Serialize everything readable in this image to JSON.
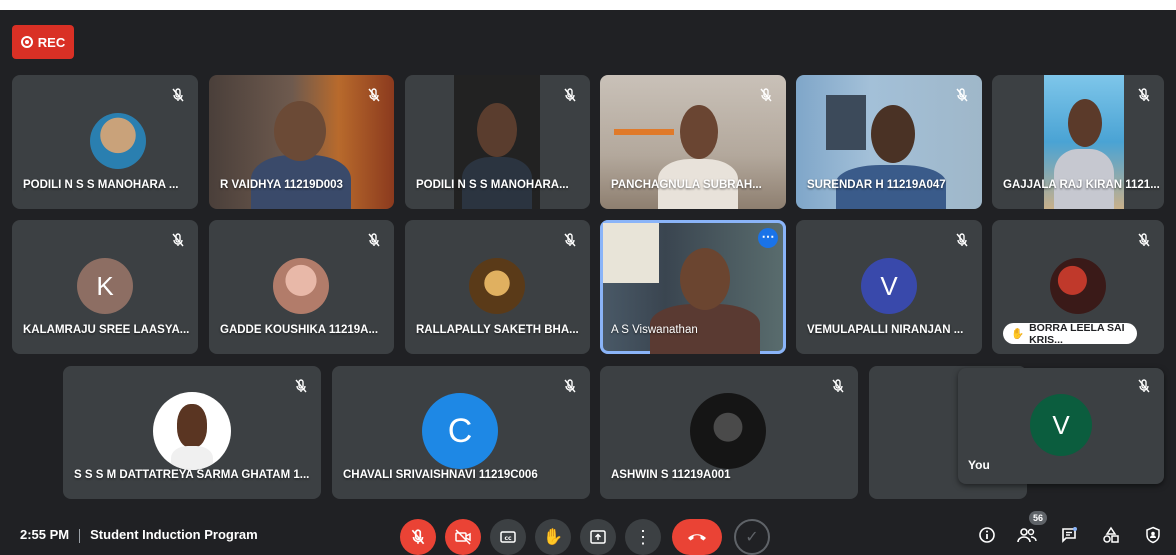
{
  "recording": {
    "label": "REC"
  },
  "participants": [
    {
      "name": "PODILI N S S MANOHARA ..."
    },
    {
      "name": "R VAIDHYA 11219D003"
    },
    {
      "name": "PODILI N S S MANOHARA..."
    },
    {
      "name": "PANCHAGNULA SUBRAH..."
    },
    {
      "name": "SURENDAR H 11219A047"
    },
    {
      "name": "GAJJALA RAJ KIRAN 1121..."
    },
    {
      "name": "KALAMRAJU SREE LAASYA...",
      "initial": "K"
    },
    {
      "name": "GADDE KOUSHIKA 11219A..."
    },
    {
      "name": "RALLAPALLY SAKETH BHA..."
    },
    {
      "name": "A S Viswanathan"
    },
    {
      "name": "VEMULAPALLI NIRANJAN ...",
      "initial": "V"
    },
    {
      "name": "BORRA LEELA SAI KRIS..."
    },
    {
      "name": "S S S M DATTATREYA SARMA GHATAM 1..."
    },
    {
      "name": "CHAVALI SRIVAISHNAVI 11219C006",
      "initial": "C"
    },
    {
      "name": "ASHWIN S 11219A001"
    }
  ],
  "self_view": {
    "label": "You",
    "initial": "V"
  },
  "meeting": {
    "time": "2:55 PM",
    "title": "Student Induction Program"
  },
  "people_count": "56",
  "colors": {
    "background": "#202124",
    "tile": "#3c4043",
    "red": "#ea4335",
    "accent": "#1a73e8",
    "avatar_k": "#8d6e63",
    "avatar_v": "#3949ab",
    "avatar_c": "#1e88e5",
    "avatar_self": "#0b5d3e"
  },
  "icons": {
    "tile_status": "mic-off-icon",
    "controls": [
      "mic-off-icon",
      "camera-off-icon",
      "captions-icon",
      "raise-hand-icon",
      "present-icon",
      "more-options-icon",
      "end-call-icon",
      "check-icon"
    ],
    "right_tools": [
      "info-icon",
      "people-icon",
      "chat-icon",
      "activities-icon",
      "host-controls-icon"
    ]
  }
}
